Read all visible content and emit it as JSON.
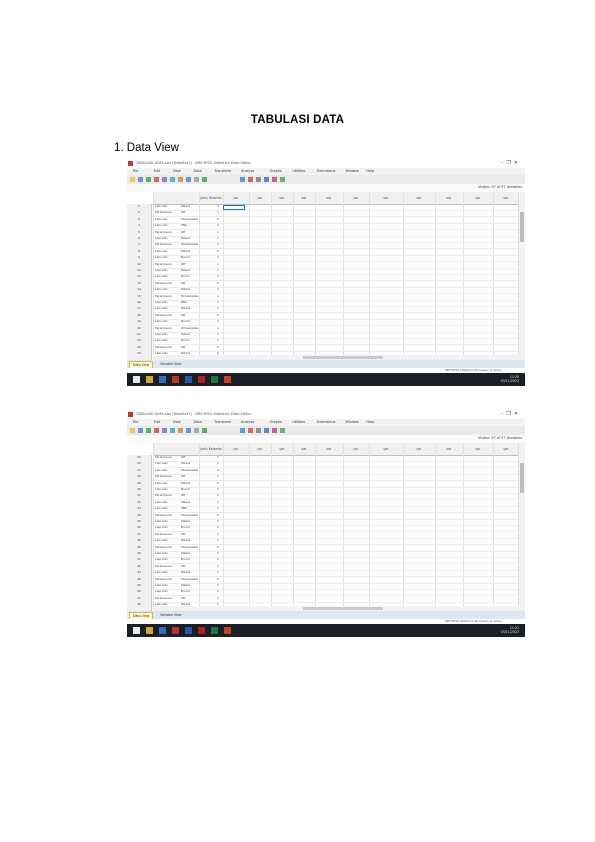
{
  "document": {
    "title": "TABULASI DATA",
    "section": "1. Data View"
  },
  "screenshots": [
    {
      "window_title": "TABULASI DATA.sav [DataSet1] - IBM SPSS Statistics Data Editor",
      "menu": [
        "File",
        "Edit",
        "View",
        "Data",
        "Transform",
        "Analyze",
        "Graphs",
        "Utilities",
        "Extensions",
        "Window",
        "Help"
      ],
      "visible_label": "Visible: 97 of 97 Variables",
      "columns": [
        "",
        "Jenis Kelamin",
        "var",
        "var",
        "var",
        "var",
        "var",
        "var",
        "var",
        "var",
        "var",
        "var",
        "var"
      ],
      "rows": [
        {
          "n": "1",
          "a": "Laki-laki",
          "b": "Petani",
          "c": "1"
        },
        {
          "n": "2",
          "a": "Perempuan",
          "b": "IRT",
          "c": "1"
        },
        {
          "n": "3",
          "a": "Laki-laki",
          "b": "Wiraswasta",
          "c": "1"
        },
        {
          "n": "4",
          "a": "Laki-laki",
          "b": "PNS",
          "c": "2"
        },
        {
          "n": "5",
          "a": "Perempuan",
          "b": "IRT",
          "c": "1"
        },
        {
          "n": "6",
          "a": "Laki-laki",
          "b": "Petani",
          "c": "1"
        },
        {
          "n": "7",
          "a": "Perempuan",
          "b": "Wiraswasta",
          "c": "2"
        },
        {
          "n": "8",
          "a": "Laki-laki",
          "b": "Petani",
          "c": "1"
        },
        {
          "n": "9",
          "a": "Laki-laki",
          "b": "Buruh",
          "c": "1"
        },
        {
          "n": "10",
          "a": "Perempuan",
          "b": "IRT",
          "c": "1"
        },
        {
          "n": "11",
          "a": "Laki-laki",
          "b": "Petani",
          "c": "1"
        },
        {
          "n": "12",
          "a": "Laki-laki",
          "b": "Buruh",
          "c": "2"
        },
        {
          "n": "13",
          "a": "Perempuan",
          "b": "IRT",
          "c": "1"
        },
        {
          "n": "14",
          "a": "Laki-laki",
          "b": "Petani",
          "c": "1"
        },
        {
          "n": "15",
          "a": "Perempuan",
          "b": "Wiraswasta",
          "c": "1"
        },
        {
          "n": "16",
          "a": "Laki-laki",
          "b": "PNS",
          "c": "2"
        },
        {
          "n": "17",
          "a": "Laki-laki",
          "b": "Petani",
          "c": "1"
        },
        {
          "n": "18",
          "a": "Perempuan",
          "b": "IRT",
          "c": "1"
        },
        {
          "n": "19",
          "a": "Laki-laki",
          "b": "Buruh",
          "c": "1"
        },
        {
          "n": "20",
          "a": "Perempuan",
          "b": "Wiraswasta",
          "c": "1"
        },
        {
          "n": "21",
          "a": "Laki-laki",
          "b": "Petani",
          "c": "2"
        },
        {
          "n": "22",
          "a": "Laki-laki",
          "b": "Buruh",
          "c": "1"
        },
        {
          "n": "23",
          "a": "Perempuan",
          "b": "IRT",
          "c": "1"
        },
        {
          "n": "24",
          "a": "Laki-laki",
          "b": "Petani",
          "c": "1"
        }
      ],
      "tabs": [
        "Data View",
        "Variable View"
      ],
      "status": "IBM SPSS Statistics Processor is ready",
      "clock": "11:20",
      "date": "03/11/2023"
    },
    {
      "window_title": "TABULASI DATA.sav [DataSet1] - IBM SPSS Statistics Data Editor",
      "menu": [
        "File",
        "Edit",
        "View",
        "Data",
        "Transform",
        "Analyze",
        "Graphs",
        "Utilities",
        "Extensions",
        "Window",
        "Help"
      ],
      "visible_label": "Visible: 97 of 97 Variables",
      "columns": [
        "",
        "Jenis Kelamin",
        "var",
        "var",
        "var",
        "var",
        "var",
        "var",
        "var",
        "var",
        "var",
        "var",
        "var"
      ],
      "rows": [
        {
          "n": "25",
          "a": "Perempuan",
          "b": "IRT",
          "c": "1"
        },
        {
          "n": "26",
          "a": "Laki-laki",
          "b": "Petani",
          "c": "1"
        },
        {
          "n": "27",
          "a": "Laki-laki",
          "b": "Wiraswasta",
          "c": "2"
        },
        {
          "n": "28",
          "a": "Perempuan",
          "b": "IRT",
          "c": "1"
        },
        {
          "n": "29",
          "a": "Laki-laki",
          "b": "Petani",
          "c": "1"
        },
        {
          "n": "30",
          "a": "Laki-laki",
          "b": "Buruh",
          "c": "1"
        },
        {
          "n": "31",
          "a": "Perempuan",
          "b": "IRT",
          "c": "2"
        },
        {
          "n": "32",
          "a": "Laki-laki",
          "b": "Petani",
          "c": "1"
        },
        {
          "n": "33",
          "a": "Laki-laki",
          "b": "PNS",
          "c": "1"
        },
        {
          "n": "34",
          "a": "Perempuan",
          "b": "Wiraswasta",
          "c": "1"
        },
        {
          "n": "35",
          "a": "Laki-laki",
          "b": "Petani",
          "c": "1"
        },
        {
          "n": "36",
          "a": "Laki-laki",
          "b": "Buruh",
          "c": "2"
        },
        {
          "n": "37",
          "a": "Perempuan",
          "b": "IRT",
          "c": "1"
        },
        {
          "n": "38",
          "a": "Laki-laki",
          "b": "Petani",
          "c": "1"
        },
        {
          "n": "39",
          "a": "Perempuan",
          "b": "Wiraswasta",
          "c": "1"
        },
        {
          "n": "40",
          "a": "Laki-laki",
          "b": "Petani",
          "c": "1"
        },
        {
          "n": "41",
          "a": "Laki-laki",
          "b": "Buruh",
          "c": "2"
        },
        {
          "n": "42",
          "a": "Perempuan",
          "b": "IRT",
          "c": "1"
        },
        {
          "n": "43",
          "a": "Laki-laki",
          "b": "Petani",
          "c": "1"
        },
        {
          "n": "44",
          "a": "Perempuan",
          "b": "Wiraswasta",
          "c": "1"
        },
        {
          "n": "45",
          "a": "Laki-laki",
          "b": "Petani",
          "c": "1"
        },
        {
          "n": "46",
          "a": "Laki-laki",
          "b": "Buruh",
          "c": "2"
        },
        {
          "n": "47",
          "a": "Perempuan",
          "b": "IRT",
          "c": "1"
        },
        {
          "n": "48",
          "a": "Laki-laki",
          "b": "Petani",
          "c": "1"
        }
      ],
      "tabs": [
        "Data View",
        "Variable View"
      ],
      "status": "IBM SPSS Statistics Processor is ready",
      "clock": "11:21",
      "date": "03/11/2023"
    }
  ]
}
